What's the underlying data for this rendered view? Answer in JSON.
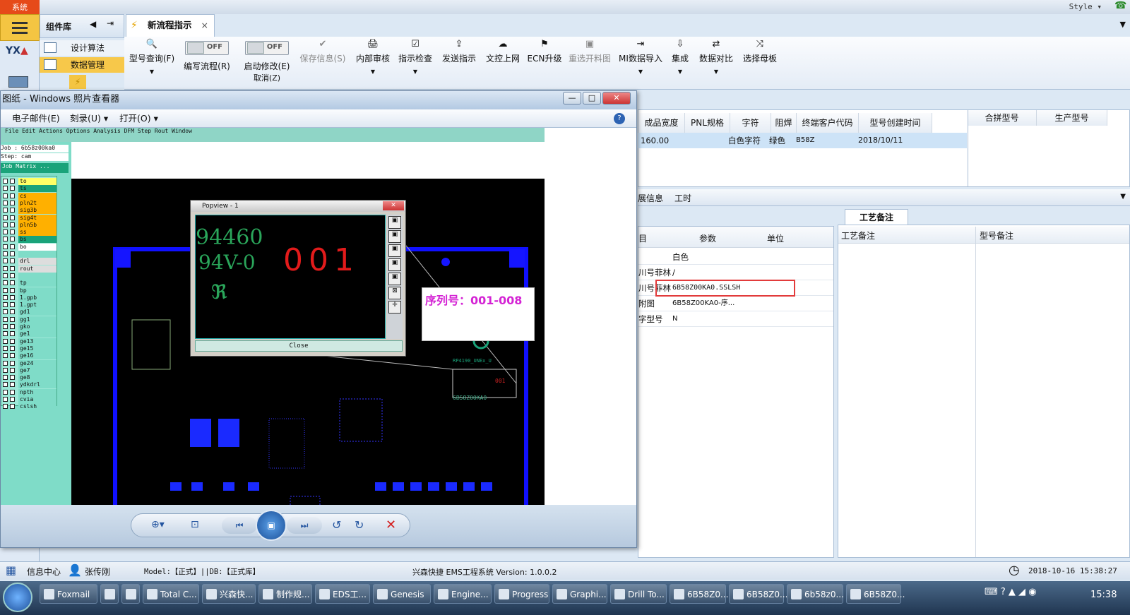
{
  "top": {
    "sys_tab": "系统",
    "style_label": "Style ▾"
  },
  "component_lib": {
    "title": "组件库",
    "items": [
      "设计算法",
      "数据管理"
    ]
  },
  "tab": {
    "label": "新流程指示",
    "close": "×"
  },
  "toolbar": {
    "items": [
      {
        "label": "型号查询(F)",
        "icon": "🔍"
      },
      {
        "label": "编写流程(R)",
        "toggle": "OFF"
      },
      {
        "label": "启动修改(E)",
        "toggle": "OFF",
        "sub": "取消(Z)"
      },
      {
        "label": "保存信息(S)",
        "icon": "✔"
      },
      {
        "label": "内部审核",
        "icon": "🖨"
      },
      {
        "label": "指示检查",
        "icon": "☑"
      },
      {
        "label": "发送指示",
        "icon": "⇪"
      },
      {
        "label": "文控上网",
        "icon": "☁"
      },
      {
        "label": "ECN升级",
        "icon": "⚑"
      },
      {
        "label": "重选开料图",
        "icon": "▣"
      },
      {
        "label": "MI数据导入",
        "icon": "⇥"
      },
      {
        "label": "集成",
        "icon": "⇩"
      },
      {
        "label": "数据对比",
        "icon": "⇄"
      },
      {
        "label": "选择母板",
        "icon": "⤨"
      }
    ]
  },
  "grid": {
    "columns": [
      "成品宽度",
      "PNL规格",
      "字符",
      "阻焊",
      "终端客户代码",
      "型号创建时间"
    ],
    "row": [
      "160.00",
      "",
      "白色字符",
      "绿色",
      "B58Z",
      "2018/10/11"
    ],
    "right_columns": [
      "合拼型号",
      "生产型号"
    ]
  },
  "mid_tabs": [
    "展信息",
    "工时"
  ],
  "params": {
    "columns": [
      "目",
      "参数",
      "单位"
    ],
    "rows": [
      {
        "name": "",
        "value": "白色"
      },
      {
        "name": "川号菲林",
        "value": "/"
      },
      {
        "name": "川号菲林",
        "value": "6B58Z00KA0.SSLSH"
      },
      {
        "name": "附图",
        "value": "6B58Z00KA0-序..."
      },
      {
        "name": "字型号",
        "value": "N"
      }
    ]
  },
  "process_notes": {
    "tab": "工艺备注",
    "columns": [
      "工艺备注",
      "型号备注"
    ]
  },
  "viewer": {
    "title": "图纸 - Windows 照片查看器",
    "menu": [
      "电子邮件(E)",
      "刻录(U) ▾",
      "打开(O) ▾"
    ],
    "genesis_menu": "File  Edit  Actions  Options  Analysis  DFM  Step  Rout  Window",
    "job": "Job : 6b58z00ka0",
    "step": "Step: cam",
    "matrix": "Job Matrix ...",
    "layers": [
      {
        "name": "to",
        "color": "#ffff66"
      },
      {
        "name": "ts",
        "color": "#1aa37a"
      },
      {
        "name": "cs",
        "color": "#ffb000"
      },
      {
        "name": "pln2t",
        "color": "#ffb000"
      },
      {
        "name": "sig3b",
        "color": "#ffb000"
      },
      {
        "name": "sig4t",
        "color": "#ffb000"
      },
      {
        "name": "pln5b",
        "color": "#ffb000"
      },
      {
        "name": "ss",
        "color": "#ffb000"
      },
      {
        "name": "bs",
        "color": "#1aa37a"
      },
      {
        "name": "bo",
        "color": "#ffffff"
      },
      {
        "name": "",
        "color": "#7fdcc8"
      },
      {
        "name": "drl",
        "color": "#dddddd"
      },
      {
        "name": "rout",
        "color": "#dddddd"
      },
      {
        "name": "",
        "color": "#7fdcc8"
      },
      {
        "name": "tp",
        "color": "#7fdcc8"
      },
      {
        "name": "bp",
        "color": "#7fdcc8"
      },
      {
        "name": "1.gpb",
        "color": "#7fdcc8"
      },
      {
        "name": "1.gpt",
        "color": "#7fdcc8"
      },
      {
        "name": "gd1",
        "color": "#7fdcc8"
      },
      {
        "name": "gg1",
        "color": "#7fdcc8"
      },
      {
        "name": "gko",
        "color": "#7fdcc8"
      },
      {
        "name": "ge1",
        "color": "#7fdcc8"
      },
      {
        "name": "ge13",
        "color": "#7fdcc8"
      },
      {
        "name": "ge15",
        "color": "#7fdcc8"
      },
      {
        "name": "ge16",
        "color": "#7fdcc8"
      },
      {
        "name": "ge24",
        "color": "#7fdcc8"
      },
      {
        "name": "ge7",
        "color": "#7fdcc8"
      },
      {
        "name": "ge8",
        "color": "#7fdcc8"
      },
      {
        "name": "ydkdrl",
        "color": "#7fdcc8"
      },
      {
        "name": "npth",
        "color": "#7fdcc8"
      },
      {
        "name": "cvia",
        "color": "#7fdcc8"
      },
      {
        "name": "cslsh",
        "color": "#7fdcc8"
      }
    ],
    "popview": {
      "title": "Popview - 1",
      "text_left": "94460",
      "text_rating": "94V-0",
      "text_serial": "001",
      "close": "Close"
    },
    "callout": "序列号：001-008",
    "board_label": "6B58Z00KA0",
    "board_serial": "001",
    "board_ul": "RP4190_UNEx_U"
  },
  "status": {
    "info": "信息中心",
    "user": "张传刚",
    "model": "Model:【正式】||DB:【正式库】",
    "system": "兴森快捷 EMS工程系统 Version: 1.0.0.2",
    "datetime": "2018-10-16 15:38:27"
  },
  "taskbar": {
    "items": [
      "Foxmail",
      "",
      "",
      "Total C...",
      "兴森快...",
      "制作规...",
      "EDS工...",
      "Genesis",
      "Engine...",
      "Progress",
      "Graphi...",
      "Drill To...",
      "6B58Z0...",
      "6B58Z0...",
      "6b58z0...",
      "6B58Z0..."
    ],
    "clock": "15:38"
  }
}
